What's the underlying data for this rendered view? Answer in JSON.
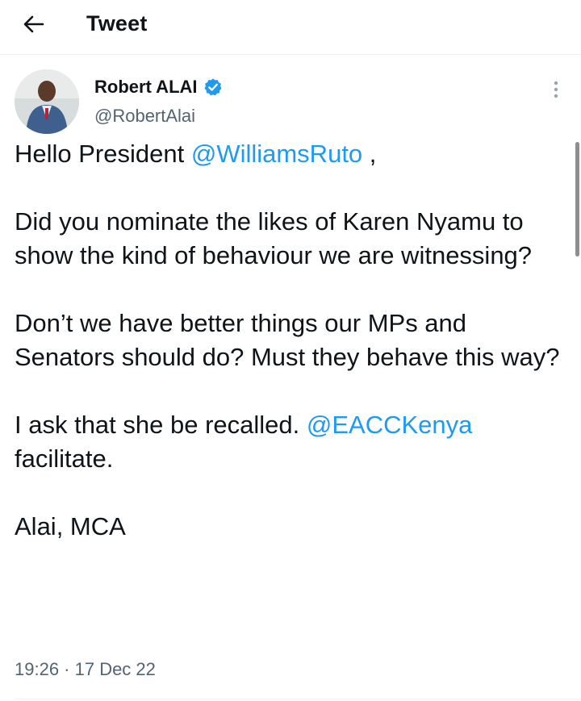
{
  "header": {
    "title": "Tweet",
    "back_icon": "arrow-left-icon"
  },
  "author": {
    "name": "Robert ALAI",
    "handle": "@RobertAlai",
    "verified": true,
    "verified_icon": "verified-badge-icon",
    "verified_color": "#1d9bf0"
  },
  "more_icon": "vertical-ellipsis-icon",
  "tweet": {
    "line1_prefix": "Hello President ",
    "mention1": "@WilliamsRuto",
    "line1_suffix": " ,",
    "para2": "Did you nominate the likes of Karen Nyamu to show the kind of behaviour we are witnessing?",
    "para3": "Don’t we have better things our MPs and Senators should do? Must they behave this way?",
    "para4_prefix": "I ask that she be recalled. ",
    "mention2": "@EACCKenya",
    "para4_suffix": " facilitate.",
    "para5": "Alai, MCA"
  },
  "timestamp": "19:26 · 17 Dec 22",
  "colors": {
    "link": "#1d9bf0",
    "text": "#0f1419",
    "secondary": "#536471"
  }
}
